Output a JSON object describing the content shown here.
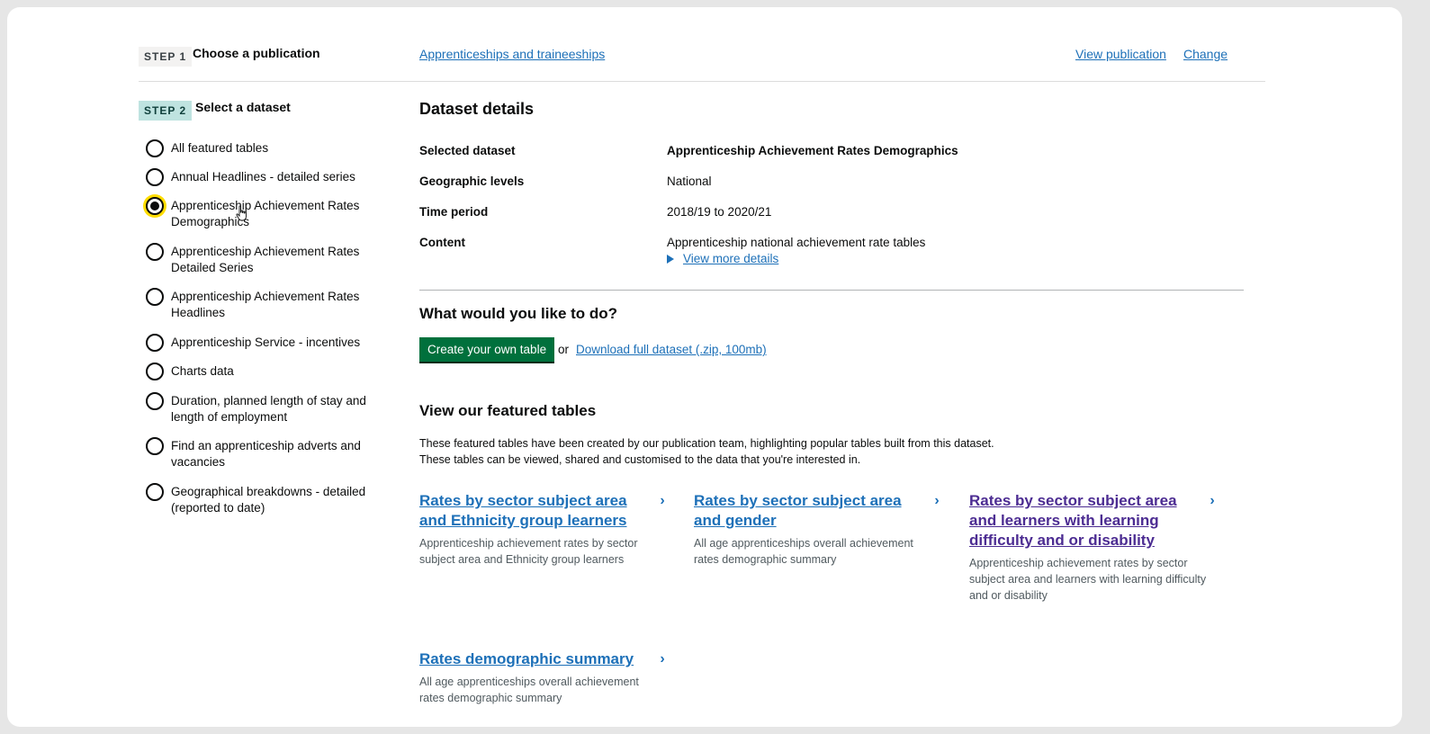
{
  "step1": {
    "tag": "STEP 1",
    "title": "Choose a publication",
    "publication_link": "Apprenticeships and traineeships",
    "view_publication": "View publication",
    "change": "Change"
  },
  "step2": {
    "tag": "STEP 2",
    "title": "Select a dataset",
    "datasets": [
      {
        "label": "All featured tables",
        "selected": false
      },
      {
        "label": "Annual Headlines - detailed series",
        "selected": false
      },
      {
        "label": "Apprenticeship Achievement Rates Demographics",
        "selected": true
      },
      {
        "label": "Apprenticeship Achievement Rates Detailed Series",
        "selected": false
      },
      {
        "label": "Apprenticeship Achievement Rates Headlines",
        "selected": false
      },
      {
        "label": "Apprenticeship Service - incentives",
        "selected": false
      },
      {
        "label": "Charts data",
        "selected": false
      },
      {
        "label": "Duration, planned length of stay and length of employment",
        "selected": false
      },
      {
        "label": "Find an apprenticeship adverts and vacancies",
        "selected": false
      },
      {
        "label": "Geographical breakdowns - detailed (reported to date)",
        "selected": false
      }
    ]
  },
  "details": {
    "heading": "Dataset details",
    "rows": [
      {
        "key": "Selected dataset",
        "value": "Apprenticeship Achievement Rates Demographics"
      },
      {
        "key": "Geographic levels",
        "value": "National"
      },
      {
        "key": "Time period",
        "value": "2018/19 to 2020/21"
      },
      {
        "key": "Content",
        "value": "Apprenticeship national achievement rate tables"
      }
    ],
    "view_more": "View more details"
  },
  "todo": {
    "heading": "What would you like to do?",
    "create_button": "Create your own table",
    "or": "or",
    "download_link": "Download full dataset (.zip, 100mb)"
  },
  "featured": {
    "heading": "View our featured tables",
    "description_line1": "These featured tables have been created by our publication team, highlighting popular tables built from this dataset.",
    "description_line2": "These tables can be viewed, shared and customised to the data that you're interested in.",
    "cards": [
      {
        "title": "Rates by sector subject area and Ethnicity group learners",
        "description": "Apprenticeship achievement rates by sector subject area and Ethnicity group learners"
      },
      {
        "title": "Rates by sector subject area and gender",
        "description": "All age apprenticeships overall achievement rates demographic summary"
      },
      {
        "title": "Rates by sector subject area and learners with learning difficulty and or disability",
        "description": "Apprenticeship achievement rates by sector subject area and learners with learning difficulty and or disability"
      },
      {
        "title": "Rates demographic summary",
        "description": "All age apprenticeships overall achievement rates demographic summary"
      }
    ]
  },
  "colors": {
    "link": "#1d70b8",
    "visited_link": "#4c2c92",
    "button_green": "#00703c",
    "focus_yellow": "#ffdd00",
    "step2_tag_bg": "#bfe3e0"
  }
}
